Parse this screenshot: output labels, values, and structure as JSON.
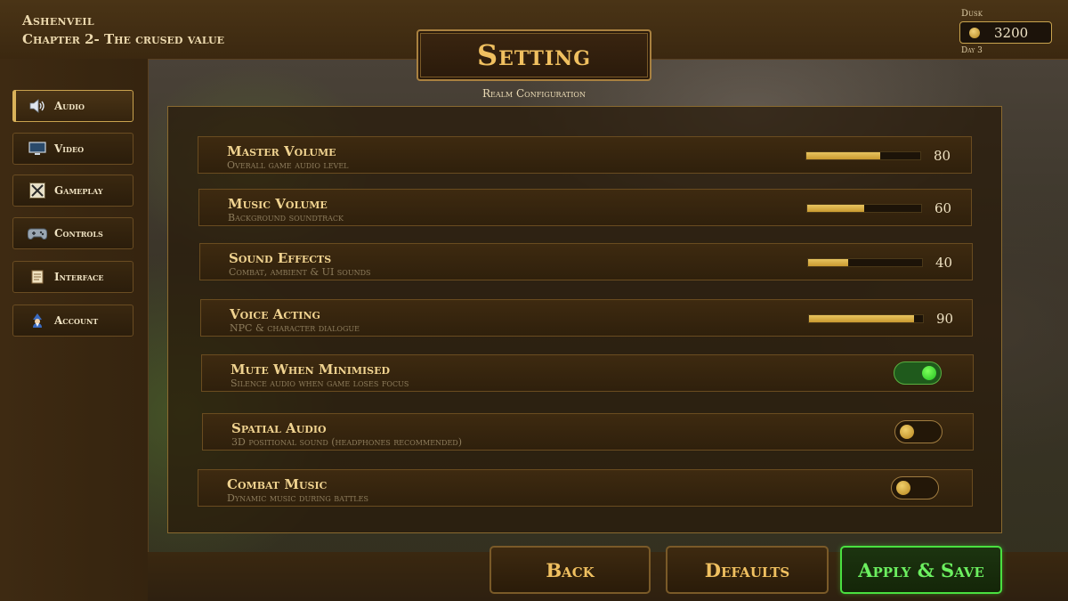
{
  "header": {
    "game_title": "Ashenveil",
    "chapter": "Chapter 2- The crused value",
    "time_of_day": "Dusk",
    "gold": "3200",
    "day": "Day 3"
  },
  "page": {
    "title": "Setting",
    "subtitle": "Realm Configuration"
  },
  "sidebar": {
    "items": [
      {
        "label": "Audio",
        "icon": "speaker-icon",
        "active": true
      },
      {
        "label": "Video",
        "icon": "monitor-icon",
        "active": false
      },
      {
        "label": "Gameplay",
        "icon": "crossed-swords-icon",
        "active": false
      },
      {
        "label": "Controls",
        "icon": "gamepad-icon",
        "active": false
      },
      {
        "label": "Interface",
        "icon": "scroll-icon",
        "active": false
      },
      {
        "label": "Account",
        "icon": "wizard-icon",
        "active": false
      }
    ]
  },
  "settings": {
    "master": {
      "title": "Master Volume",
      "desc": "Overall game audio level",
      "value": "80",
      "level": 0.65
    },
    "music": {
      "title": "Music Volume",
      "desc": "Background soundtrack",
      "value": "60",
      "level": 0.5
    },
    "sfx": {
      "title": "Sound Effects",
      "desc": "Combat, ambient & UI sounds",
      "value": "40",
      "level": 0.35
    },
    "voice": {
      "title": "Voice Acting",
      "desc": "NPC & character dialogue",
      "value": "90",
      "level": 0.92
    },
    "mute": {
      "title": "Mute When Minimised",
      "desc": "Silence audio when game loses focus",
      "on": true
    },
    "spatial": {
      "title": "Spatial Audio",
      "desc": "3D positional sound (headphones recommended)",
      "on": false
    },
    "combat": {
      "title": "Combat Music",
      "desc": "Dynamic music during battles",
      "on": false
    }
  },
  "buttons": {
    "back": "Back",
    "defaults": "Defaults",
    "apply": "Apply & Save"
  },
  "colors": {
    "accent_gold": "#f0c060",
    "accent_green": "#4ae040"
  }
}
